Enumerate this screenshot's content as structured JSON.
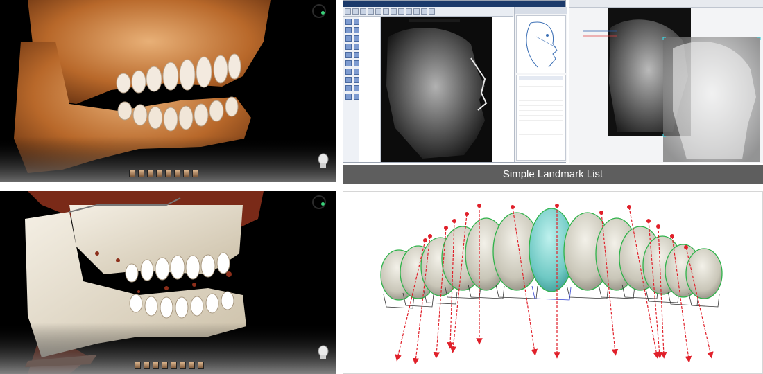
{
  "panels": {
    "ct_top": {
      "name": "3D CT volume rendering (orange)"
    },
    "ct_bottom": {
      "name": "3D CT volume rendering (bone)"
    },
    "ceph_software": {
      "caption": "Simple Landmark List"
    },
    "teeth": {
      "name": "Tooth axis simulation"
    }
  },
  "colors": {
    "caption_bg": "#5e5e5e",
    "arrow_red": "#e0202a",
    "selected_tooth": "#6fc9c4",
    "tooth_outline": "#2fb34a"
  }
}
